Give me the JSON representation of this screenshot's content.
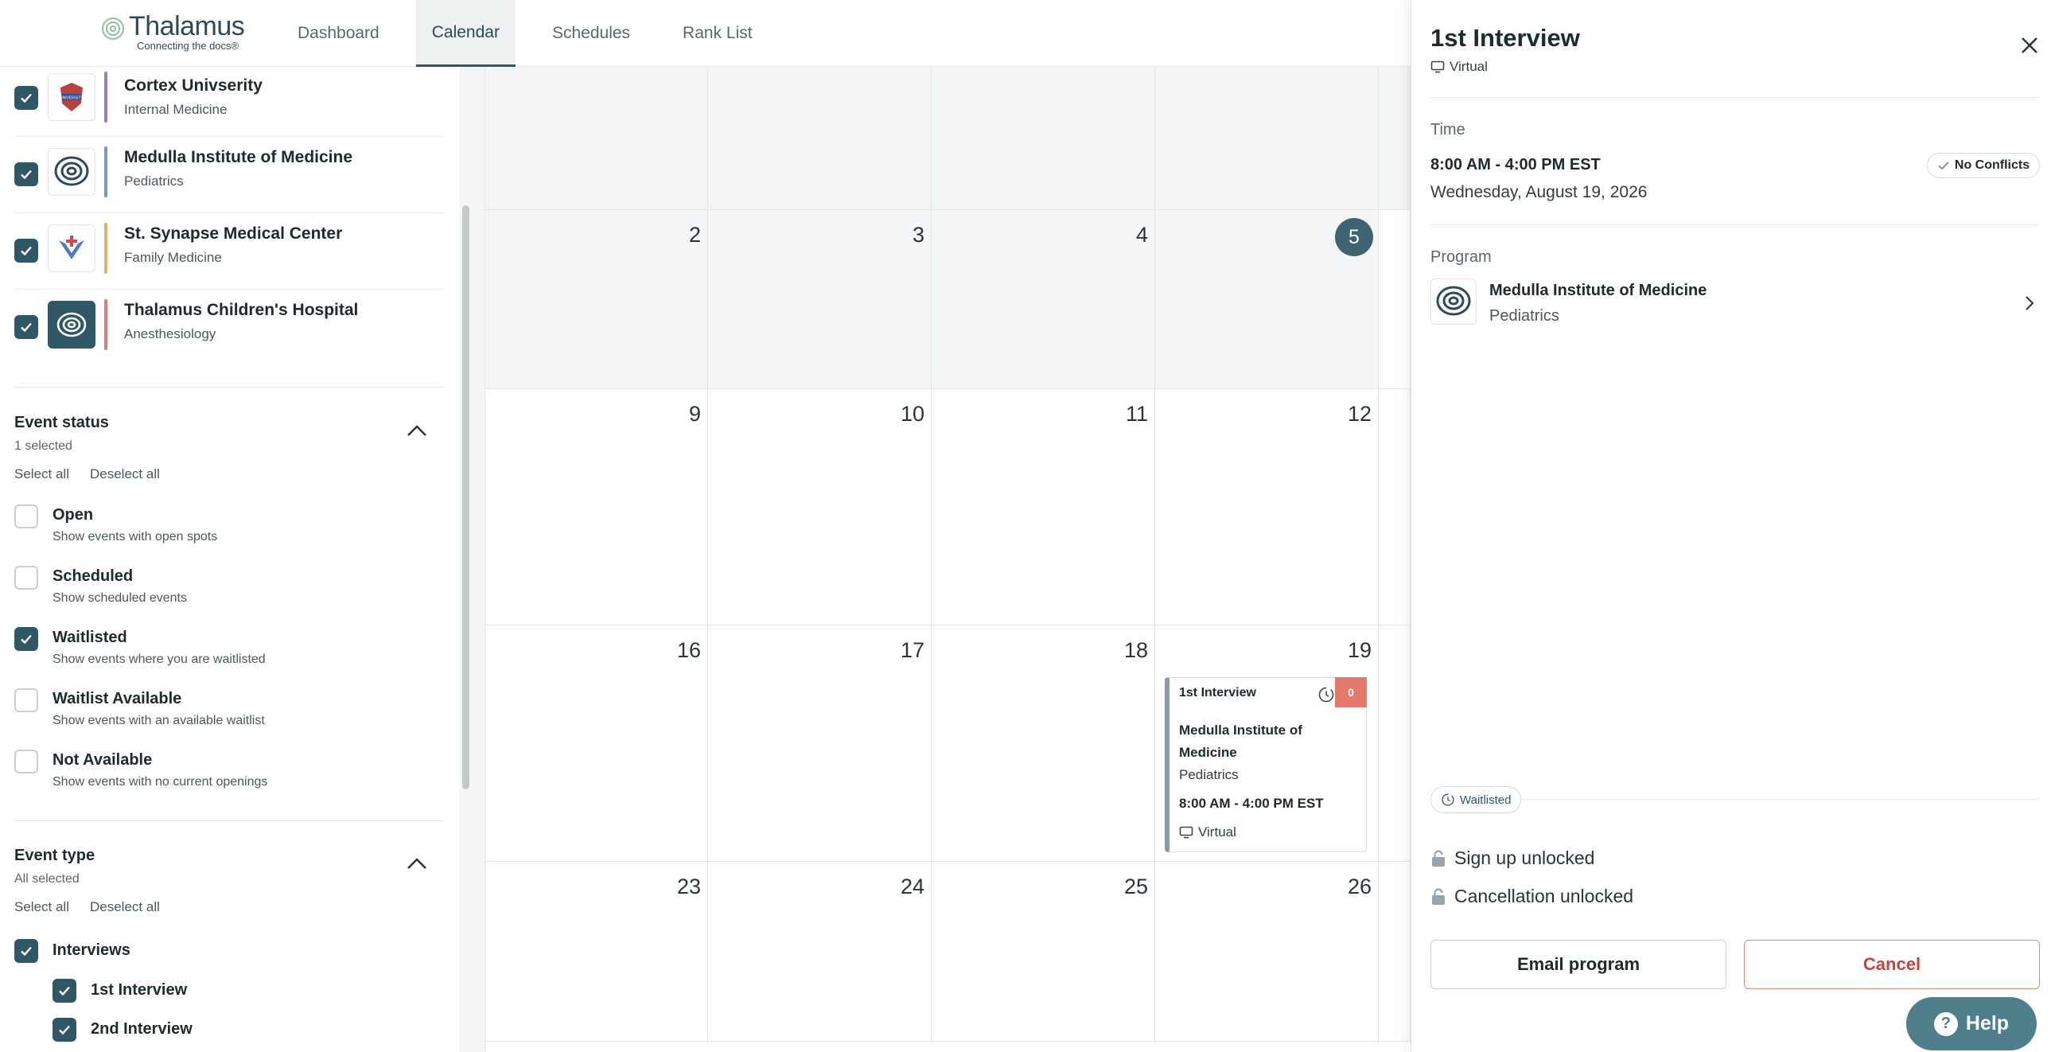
{
  "brand": {
    "name": "Thalamus",
    "tagline": "Connecting the docs®"
  },
  "nav": {
    "tabs": [
      {
        "label": "Dashboard"
      },
      {
        "label": "Calendar"
      },
      {
        "label": "Schedules"
      },
      {
        "label": "Rank List"
      }
    ],
    "active": "Calendar"
  },
  "sidebar": {
    "programs": [
      {
        "name": "Cortex Univserity",
        "specialty": "Internal Medicine",
        "checked": true,
        "color": "#9b7fb6"
      },
      {
        "name": "Medulla Institute of Medicine",
        "specialty": "Pediatrics",
        "checked": true,
        "color": "#7f95c4"
      },
      {
        "name": "St. Synapse Medical Center",
        "specialty": "Family Medicine",
        "checked": true,
        "color": "#d6b56a"
      },
      {
        "name": "Thalamus Children's Hospital",
        "specialty": "Anesthesiology",
        "checked": true,
        "color": "#d4837a"
      }
    ],
    "event_status": {
      "title": "Event status",
      "summary": "1 selected",
      "select_all": "Select all",
      "deselect_all": "Deselect all",
      "options": [
        {
          "label": "Open",
          "desc": "Show events with open spots",
          "checked": false
        },
        {
          "label": "Scheduled",
          "desc": "Show scheduled events",
          "checked": false
        },
        {
          "label": "Waitlisted",
          "desc": "Show events where you are waitlisted",
          "checked": true
        },
        {
          "label": "Waitlist Available",
          "desc": "Show events with an available waitlist",
          "checked": false
        },
        {
          "label": "Not Available",
          "desc": "Show events with no current openings",
          "checked": false
        }
      ]
    },
    "event_type": {
      "title": "Event type",
      "summary": "All selected",
      "select_all": "Select all",
      "deselect_all": "Deselect all",
      "group": "Interviews",
      "items": [
        "1st Interview",
        "2nd Interview"
      ]
    }
  },
  "calendar": {
    "rows": [
      {
        "days": [
          "",
          "",
          "",
          "",
          ""
        ]
      },
      {
        "days": [
          "2",
          "3",
          "4",
          "5",
          ""
        ]
      },
      {
        "days": [
          "9",
          "10",
          "11",
          "12",
          ""
        ]
      },
      {
        "days": [
          "16",
          "17",
          "18",
          "19",
          ""
        ]
      },
      {
        "days": [
          "23",
          "24",
          "25",
          "26",
          ""
        ]
      }
    ],
    "today": "5",
    "event": {
      "title": "1st Interview",
      "count": "0",
      "program": "Medulla Institute of Medicine",
      "specialty": "Pediatrics",
      "time": "8:00 AM - 4:00 PM EST",
      "mode": "Virtual"
    }
  },
  "panel": {
    "title": "1st Interview",
    "mode": "Virtual",
    "time_label": "Time",
    "time": "8:00 AM - 4:00 PM EST",
    "date": "Wednesday, August 19, 2026",
    "conflict_badge": "No Conflicts",
    "program_label": "Program",
    "program_name": "Medulla Institute of Medicine",
    "program_specialty": "Pediatrics",
    "status": "Waitlisted",
    "signup": "Sign up unlocked",
    "cancellation": "Cancellation unlocked",
    "email_button": "Email program",
    "cancel_button": "Cancel"
  },
  "help": {
    "label": "Help"
  },
  "colors": {
    "accent": "#2f5766",
    "danger": "#c8443a",
    "event_count": "#e47a6e"
  }
}
